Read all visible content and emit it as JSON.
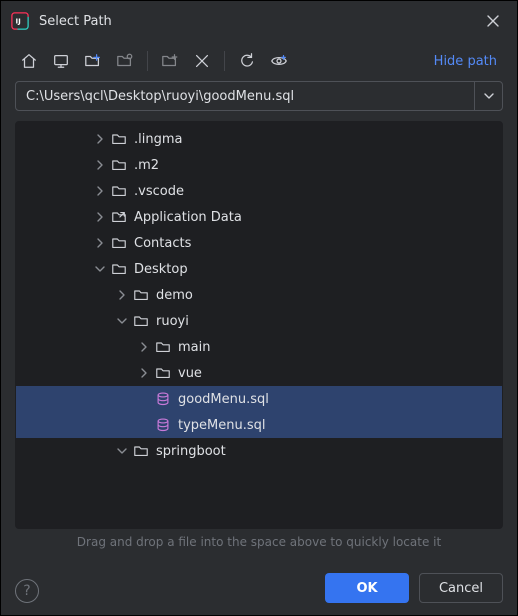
{
  "title": "Select Path",
  "path_value": "C:\\Users\\qcl\\Desktop\\ruoyi\\goodMenu.sql",
  "hide_path_label": "Hide path",
  "hint": "Drag and drop a file into the space above to quickly locate it",
  "buttons": {
    "ok": "OK",
    "cancel": "Cancel"
  },
  "help_glyph": "?",
  "tree": [
    {
      "depth": 3,
      "expand": "closed",
      "icon": "folder",
      "label": ".lingma",
      "selected": false
    },
    {
      "depth": 3,
      "expand": "closed",
      "icon": "folder",
      "label": ".m2",
      "selected": false
    },
    {
      "depth": 3,
      "expand": "closed",
      "icon": "folder",
      "label": ".vscode",
      "selected": false
    },
    {
      "depth": 3,
      "expand": "closed",
      "icon": "shortcut",
      "label": "Application Data",
      "selected": false
    },
    {
      "depth": 3,
      "expand": "closed",
      "icon": "folder",
      "label": "Contacts",
      "selected": false
    },
    {
      "depth": 3,
      "expand": "open",
      "icon": "folder",
      "label": "Desktop",
      "selected": false
    },
    {
      "depth": 4,
      "expand": "closed",
      "icon": "folder",
      "label": "demo",
      "selected": false
    },
    {
      "depth": 4,
      "expand": "open",
      "icon": "folder",
      "label": "ruoyi",
      "selected": false
    },
    {
      "depth": 5,
      "expand": "closed",
      "icon": "folder",
      "label": "main",
      "selected": false
    },
    {
      "depth": 5,
      "expand": "closed",
      "icon": "folder",
      "label": "vue",
      "selected": false
    },
    {
      "depth": 5,
      "expand": "none",
      "icon": "db",
      "label": "goodMenu.sql",
      "selected": true
    },
    {
      "depth": 5,
      "expand": "none",
      "icon": "db",
      "label": "typeMenu.sql",
      "selected": true
    },
    {
      "depth": 4,
      "expand": "open",
      "icon": "folder",
      "label": "springboot",
      "selected": false
    }
  ]
}
